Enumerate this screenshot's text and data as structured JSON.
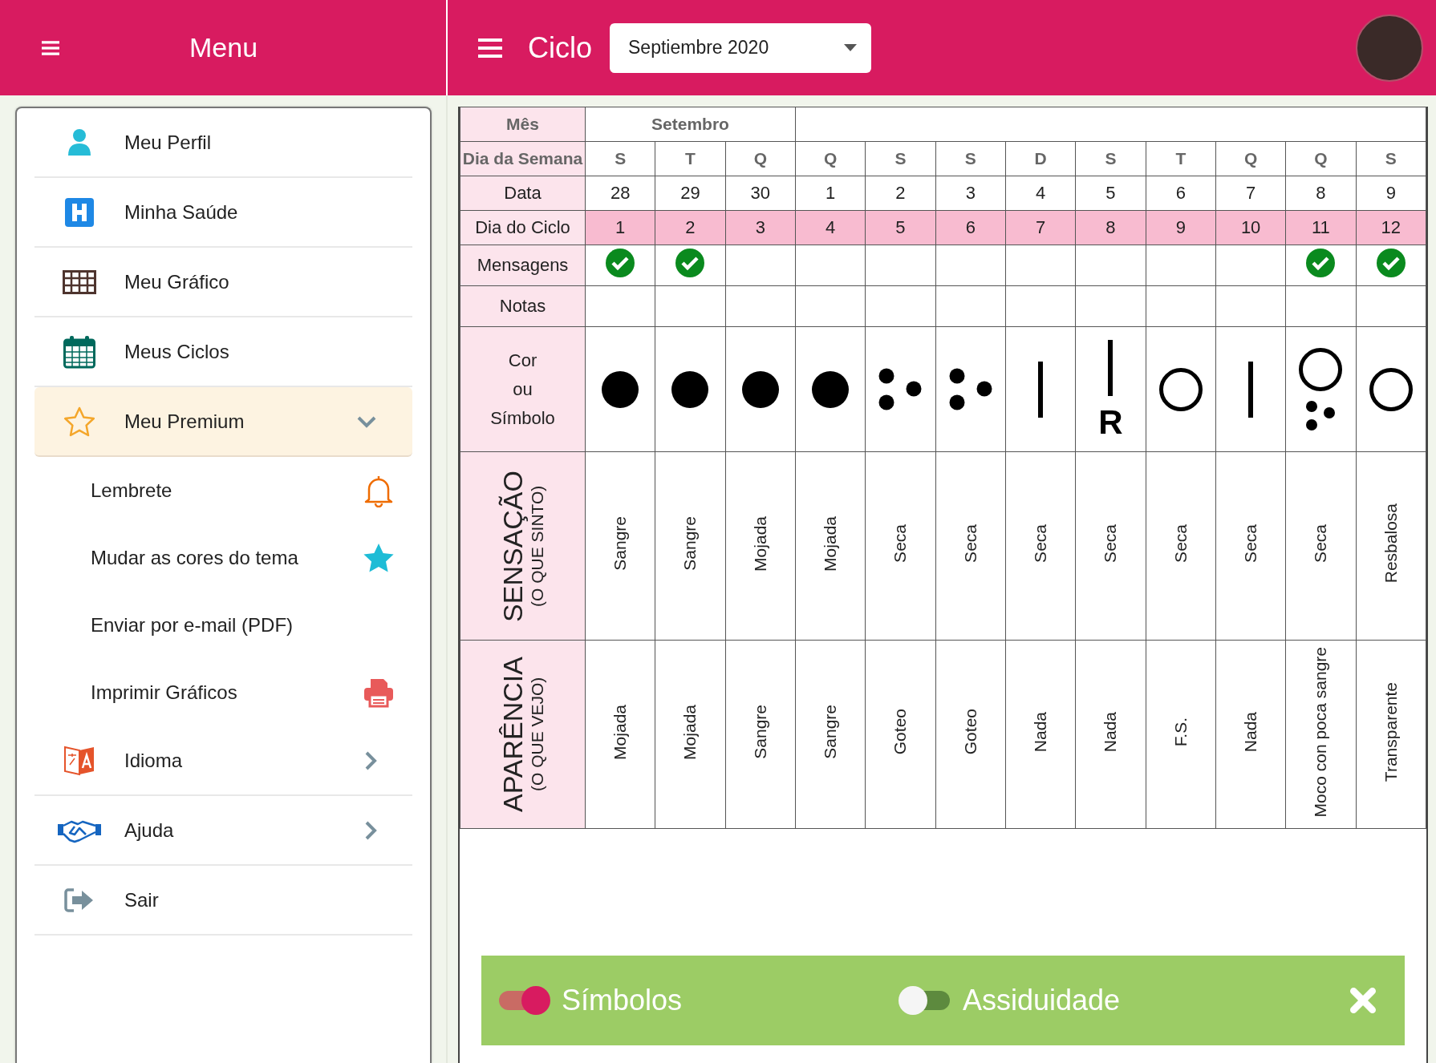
{
  "sidebar": {
    "title": "Menu",
    "items": [
      {
        "label": "Meu Perfil",
        "selected": false
      },
      {
        "label": "Minha Saúde",
        "selected": false
      },
      {
        "label": "Meu Gráfico",
        "selected": false
      },
      {
        "label": "Meus Ciclos",
        "selected": false
      },
      {
        "label": "Meu Premium",
        "selected": true,
        "expanded": true,
        "children": [
          {
            "label": "Lembrete"
          },
          {
            "label": "Mudar as cores do tema"
          },
          {
            "label": "Enviar por e-mail (PDF)"
          },
          {
            "label": "Imprimir Gráficos"
          }
        ]
      },
      {
        "label": "Idioma",
        "selected": false,
        "expanded": false
      },
      {
        "label": "Ajuda",
        "selected": false,
        "expanded": false
      },
      {
        "label": "Sair",
        "selected": false
      }
    ]
  },
  "header": {
    "title": "Ciclo",
    "month_select": "Septiembre 2020"
  },
  "table": {
    "row_labels": {
      "month": "Mês",
      "weekday": "Dia da Semana",
      "date": "Data",
      "cycle_day": "Dia do Ciclo",
      "messages": "Mensagens",
      "notes": "Notas",
      "symbol": [
        "Cor",
        "ou",
        "Símbolo"
      ],
      "sensation": {
        "title": "SENSAÇÃO",
        "subtitle": "(O QUE SINTO)"
      },
      "appearance": {
        "title": "APARÊNCIA",
        "subtitle": "(O QUE VEJO)"
      }
    },
    "months": [
      {
        "label": "Setembro",
        "days": [
          {
            "weekday": "S",
            "date": "28",
            "cycle_day": "1",
            "message": true,
            "symbol": {
              "kind": "dot"
            },
            "sensation": "Sangre",
            "appearance": "Mojada"
          },
          {
            "weekday": "T",
            "date": "29",
            "cycle_day": "2",
            "message": true,
            "symbol": {
              "kind": "dot"
            },
            "sensation": "Sangre",
            "appearance": "Mojada"
          },
          {
            "weekday": "Q",
            "date": "30",
            "cycle_day": "3",
            "message": false,
            "symbol": {
              "kind": "dot"
            },
            "sensation": "Mojada",
            "appearance": "Sangre"
          }
        ]
      },
      {
        "days": [
          {
            "weekday": "Q",
            "date": "1",
            "cycle_day": "4",
            "message": false,
            "symbol": {
              "kind": "dot"
            },
            "sensation": "Mojada",
            "appearance": "Sangre"
          },
          {
            "weekday": "S",
            "date": "2",
            "cycle_day": "5",
            "message": false,
            "symbol": {
              "kind": "dots"
            },
            "sensation": "Seca",
            "appearance": "Goteo"
          },
          {
            "weekday": "S",
            "date": "3",
            "cycle_day": "6",
            "message": false,
            "symbol": {
              "kind": "dots"
            },
            "sensation": "Seca",
            "appearance": "Goteo"
          },
          {
            "weekday": "D",
            "date": "4",
            "cycle_day": "7",
            "message": false,
            "symbol": {
              "kind": "line"
            },
            "sensation": "Seca",
            "appearance": "Nada"
          },
          {
            "weekday": "S",
            "date": "5",
            "cycle_day": "8",
            "message": false,
            "symbol": {
              "kind": "line",
              "mark": "R"
            },
            "sensation": "Seca",
            "appearance": "Nada"
          },
          {
            "weekday": "T",
            "date": "6",
            "cycle_day": "9",
            "message": false,
            "symbol": {
              "kind": "circle"
            },
            "sensation": "Seca",
            "appearance": "F.S."
          },
          {
            "weekday": "Q",
            "date": "7",
            "cycle_day": "10",
            "message": false,
            "symbol": {
              "kind": "line"
            },
            "sensation": "Seca",
            "appearance": "Nada"
          },
          {
            "weekday": "Q",
            "date": "8",
            "cycle_day": "11",
            "message": true,
            "symbol": {
              "kind": "circle-dots"
            },
            "sensation": "Seca",
            "appearance": "Moco con poca sangre"
          },
          {
            "weekday": "S",
            "date": "9",
            "cycle_day": "12",
            "message": true,
            "symbol": {
              "kind": "circle"
            },
            "sensation": "Resbalosa",
            "appearance": "Transparente"
          }
        ]
      }
    ]
  },
  "toggle_bar": {
    "toggles": [
      {
        "label": "Símbolos",
        "on": true
      },
      {
        "label": "Assiduidade",
        "on": false
      }
    ]
  }
}
